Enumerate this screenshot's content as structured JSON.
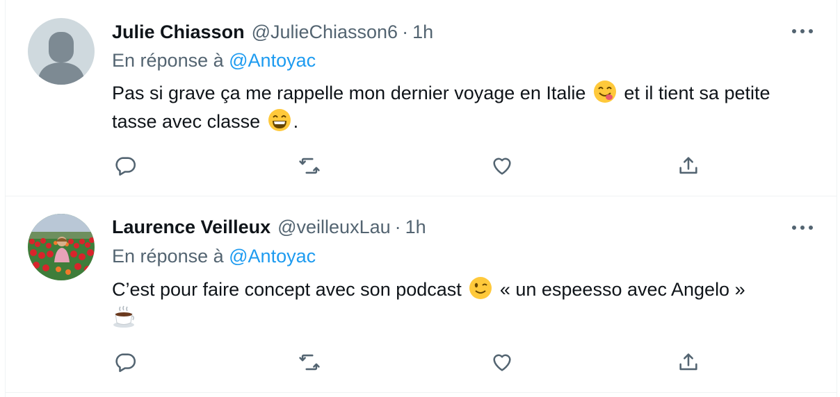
{
  "tweets": [
    {
      "name": "Julie Chiasson",
      "handle": "@JulieChiasson6",
      "separator": "·",
      "time": "1h",
      "reply_prefix": "En réponse à",
      "reply_to": "@Antoyac",
      "text_parts": [
        "Pas si grave ça me rappelle mon dernier voyage en Italie",
        "et il tient sa petite tasse avec classe",
        "."
      ],
      "emojis": [
        "yum-face-emoji",
        "grinning-face-emoji"
      ],
      "avatar": "default-avatar"
    },
    {
      "name": "Laurence Veilleux",
      "handle": "@veilleuxLau",
      "separator": "·",
      "time": "1h",
      "reply_prefix": "En réponse à",
      "reply_to": "@Antoyac",
      "text_parts": [
        "C’est pour faire concept avec son podcast",
        "« un espeesso avec Angelo »"
      ],
      "emojis": [
        "winking-face-emoji",
        "hot-beverage-emoji"
      ],
      "avatar": "tulip-field-photo"
    }
  ],
  "actions": [
    "reply-icon",
    "retweet-icon",
    "like-icon",
    "share-icon"
  ],
  "colors": {
    "text": "#0f1419",
    "secondary": "#536471",
    "link": "#1d9bf0",
    "border": "#eff3f4"
  }
}
